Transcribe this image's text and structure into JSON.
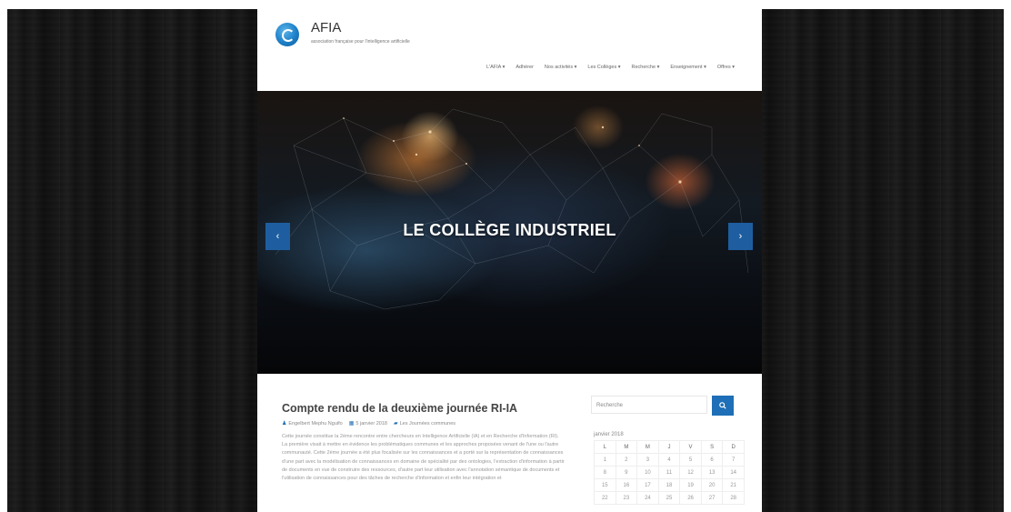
{
  "site": {
    "title": "AFIA",
    "tagline": "association française pour l'intelligence artificielle"
  },
  "nav": [
    "L'AFIA ▾",
    "Adhérer",
    "Nos activités ▾",
    "Les Collèges ▾",
    "Recherche ▾",
    "Enseignement ▾",
    "Offres ▾"
  ],
  "slider": {
    "caption": "LE COLLÈGE INDUSTRIEL",
    "prev_label": "‹",
    "next_label": "›"
  },
  "post": {
    "title": "Compte rendu de la deuxième journée RI-IA",
    "author": "Engelbert Mephu Nguifo",
    "date": "5 janvier 2018",
    "category": "Les Journées communes",
    "excerpt": "Cette journée constitue la 2ème rencontre entre chercheurs en Intelligence Artificielle (IA) et en Recherche d'Information (RI). La première visait à mettre en évidence les problématiques communes et les approches proposées venant de l'une ou l'autre communauté. Cette 2ème journée a été plus focalisée sur les connaissances et a porté sur la représentation de connaissances d'une part avec la modélisation de connaissances en domaine de spécialité par des ontologies, l'extraction d'information à partir de documents en vue de construire des ressources, d'autre part leur utilisation avec l'annotation sémantique de documents et l'utilisation de connaissances pour des tâches de recherche d'information et enfin leur intégration et"
  },
  "sidebar": {
    "search_placeholder": "Recherche",
    "calendar": {
      "caption": "janvier 2018",
      "days": [
        "L",
        "M",
        "M",
        "J",
        "V",
        "S",
        "D"
      ],
      "weeks": [
        [
          "1",
          "2",
          "3",
          "4",
          "5",
          "6",
          "7"
        ],
        [
          "8",
          "9",
          "10",
          "11",
          "12",
          "13",
          "14"
        ],
        [
          "15",
          "16",
          "17",
          "18",
          "19",
          "20",
          "21"
        ],
        [
          "22",
          "23",
          "24",
          "25",
          "26",
          "27",
          "28"
        ]
      ]
    }
  },
  "icons": {
    "author": "user-icon",
    "date": "calendar-icon",
    "category": "folder-icon",
    "search": "search-icon"
  },
  "colors": {
    "accent": "#1e6fb7",
    "slider_button": "#1e5ea0"
  }
}
